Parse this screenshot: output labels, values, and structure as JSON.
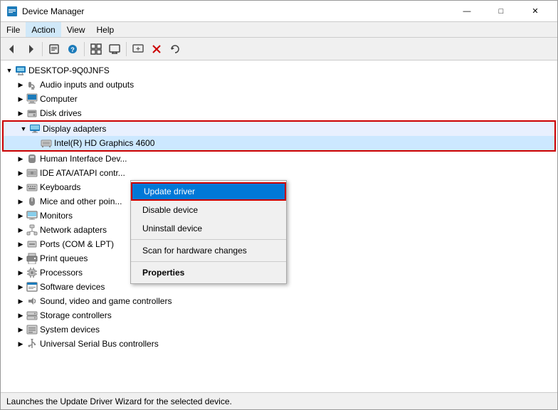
{
  "window": {
    "title": "Device Manager",
    "title_icon": "⚙"
  },
  "menu": {
    "items": [
      "File",
      "Action",
      "View",
      "Help"
    ]
  },
  "toolbar": {
    "buttons": [
      "◀",
      "▶",
      "⊞",
      "⊟",
      "?",
      "⊡",
      "🖥",
      "⊕",
      "✖",
      "🔃"
    ]
  },
  "tree": {
    "root": {
      "label": "DESKTOP-9Q0JNFS",
      "expanded": true
    },
    "items": [
      {
        "id": "audio",
        "label": "Audio inputs and outputs",
        "indent": 1,
        "icon": "🔊",
        "expanded": false
      },
      {
        "id": "computer",
        "label": "Computer",
        "indent": 1,
        "icon": "💻",
        "expanded": false
      },
      {
        "id": "disk",
        "label": "Disk drives",
        "indent": 1,
        "icon": "💾",
        "expanded": false
      },
      {
        "id": "display",
        "label": "Display adapters",
        "indent": 1,
        "icon": "🖥",
        "expanded": true,
        "highlighted": true
      },
      {
        "id": "intel",
        "label": "Intel(R) HD Graphics 4600",
        "indent": 2,
        "icon": "🖥",
        "selected": true
      },
      {
        "id": "hid",
        "label": "Human Interface Dev...",
        "indent": 1,
        "icon": "🎮",
        "expanded": false
      },
      {
        "id": "ide",
        "label": "IDE ATA/ATAPI contr...",
        "indent": 1,
        "icon": "💿",
        "expanded": false
      },
      {
        "id": "keyboards",
        "label": "Keyboards",
        "indent": 1,
        "icon": "⌨",
        "expanded": false
      },
      {
        "id": "mice",
        "label": "Mice and other poin...",
        "indent": 1,
        "icon": "🖱",
        "expanded": false
      },
      {
        "id": "monitors",
        "label": "Monitors",
        "indent": 1,
        "icon": "🖥",
        "expanded": false
      },
      {
        "id": "network",
        "label": "Network adapters",
        "indent": 1,
        "icon": "📶",
        "expanded": false
      },
      {
        "id": "ports",
        "label": "Ports (COM & LPT)",
        "indent": 1,
        "icon": "🔌",
        "expanded": false
      },
      {
        "id": "print",
        "label": "Print queues",
        "indent": 1,
        "icon": "🖨",
        "expanded": false
      },
      {
        "id": "processors",
        "label": "Processors",
        "indent": 1,
        "icon": "⚙",
        "expanded": false
      },
      {
        "id": "software",
        "label": "Software devices",
        "indent": 1,
        "icon": "📱",
        "expanded": false
      },
      {
        "id": "sound",
        "label": "Sound, video and game controllers",
        "indent": 1,
        "icon": "🎵",
        "expanded": false
      },
      {
        "id": "storage",
        "label": "Storage controllers",
        "indent": 1,
        "icon": "💾",
        "expanded": false
      },
      {
        "id": "system",
        "label": "System devices",
        "indent": 1,
        "icon": "⚙",
        "expanded": false
      },
      {
        "id": "usb",
        "label": "Universal Serial Bus controllers",
        "indent": 1,
        "icon": "🔌",
        "expanded": false
      }
    ]
  },
  "context_menu": {
    "items": [
      {
        "id": "update",
        "label": "Update driver",
        "highlighted": true
      },
      {
        "id": "disable",
        "label": "Disable device"
      },
      {
        "id": "uninstall",
        "label": "Uninstall device"
      },
      {
        "separator": true
      },
      {
        "id": "scan",
        "label": "Scan for hardware changes"
      },
      {
        "separator": true
      },
      {
        "id": "properties",
        "label": "Properties",
        "bold": true
      }
    ]
  },
  "status_bar": {
    "text": "Launches the Update Driver Wizard for the selected device."
  }
}
